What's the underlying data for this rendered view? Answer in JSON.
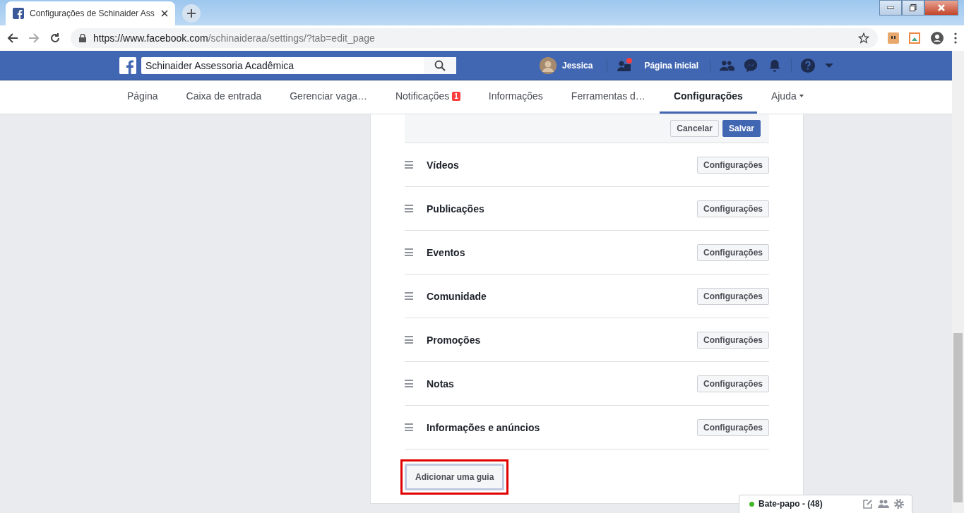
{
  "browser": {
    "tab_title": "Configurações de Schinaider Ass",
    "url_host": "https://www.facebook.com",
    "url_path": "/schinaideraa/settings/?tab=edit_page"
  },
  "topbar": {
    "search_value": "Schinaider Assessoria Acadêmica",
    "user_name": "Jessica",
    "home_label": "Página inicial"
  },
  "nav_tabs": [
    {
      "label": "Página",
      "selected": false
    },
    {
      "label": "Caixa de entrada",
      "selected": false
    },
    {
      "label": "Gerenciar vaga…",
      "selected": false
    },
    {
      "label": "Notificações",
      "selected": false,
      "badge": "1"
    },
    {
      "label": "Informações",
      "selected": false
    },
    {
      "label": "Ferramentas d…",
      "selected": false
    },
    {
      "label": "Configurações",
      "selected": true
    },
    {
      "label": "Ajuda",
      "selected": false,
      "dropdown": true
    }
  ],
  "edit_actions": {
    "cancel": "Cancelar",
    "save": "Salvar"
  },
  "sections": [
    {
      "label": "Vídeos",
      "button": "Configurações"
    },
    {
      "label": "Publicações",
      "button": "Configurações"
    },
    {
      "label": "Eventos",
      "button": "Configurações"
    },
    {
      "label": "Comunidade",
      "button": "Configurações"
    },
    {
      "label": "Promoções",
      "button": "Configurações"
    },
    {
      "label": "Notas",
      "button": "Configurações"
    },
    {
      "label": "Informações e anúncios",
      "button": "Configurações"
    }
  ],
  "add_tab_button": {
    "label": "Adicionar uma guia",
    "highlighted": true
  },
  "chat": {
    "label": "Bate-papo - (48)",
    "online": true
  }
}
